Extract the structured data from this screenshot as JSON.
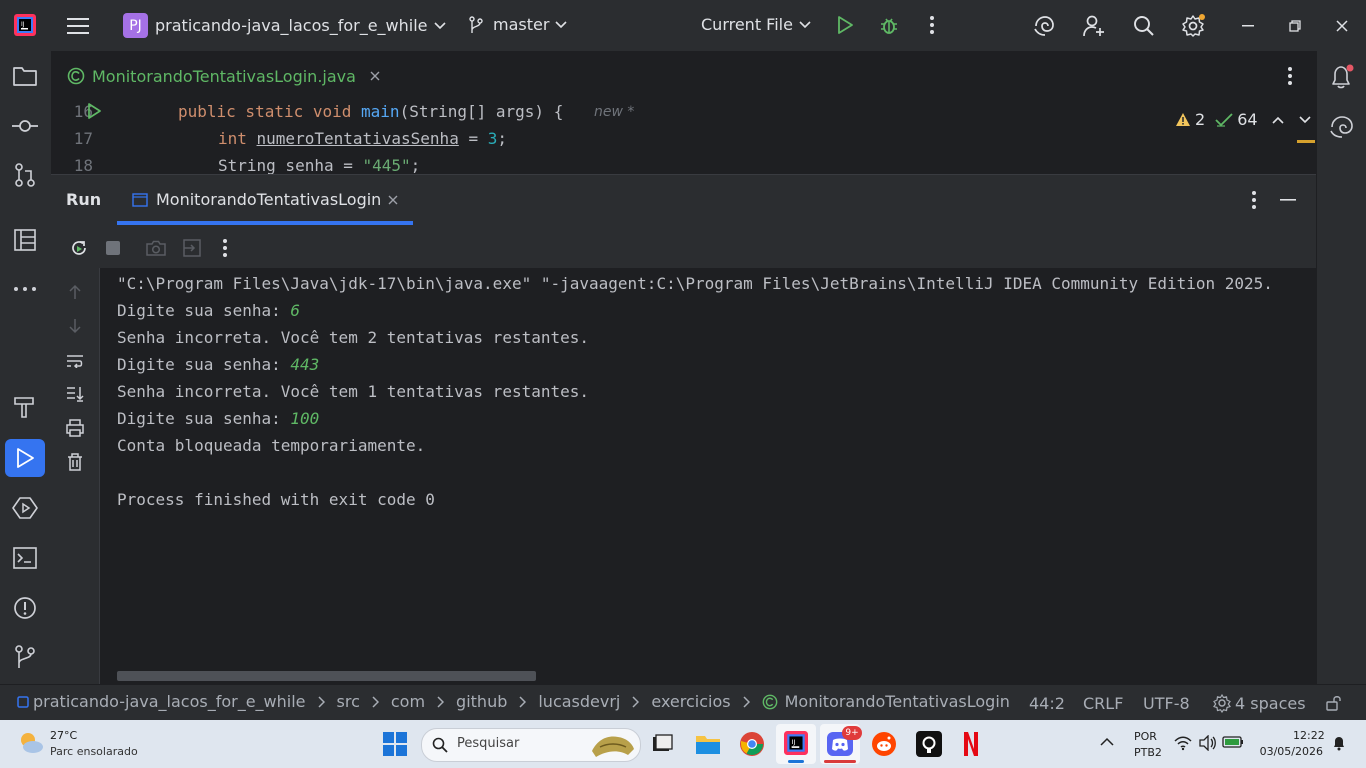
{
  "titlebar": {
    "project_badge": "PJ",
    "project_name": "praticando-java_lacos_for_e_while",
    "branch": "master",
    "run_config": "Current File",
    "window_controls": [
      "minimize-icon",
      "restore-icon",
      "close-icon"
    ]
  },
  "editor_tab": {
    "filename": "MonitorandoTentativasLogin.java"
  },
  "editor": {
    "lines": [
      {
        "num": "16",
        "code_kw": "public static void ",
        "code_fn": "main",
        "code_rest": "(String[] args) {",
        "hint": "new *"
      },
      {
        "num": "17",
        "code_kw": "int ",
        "code_var": "numeroTentativasSenha",
        "code_rest": " = ",
        "code_num": "3",
        "code_end": ";"
      },
      {
        "num": "18",
        "code_plain": "String senha = ",
        "code_str": "\"445\"",
        "code_end": ";"
      }
    ],
    "warnings": "2",
    "checks": "64"
  },
  "run_panel": {
    "title": "Run",
    "tab_label": "MonitorandoTentativasLogin"
  },
  "console": {
    "command": "\"C:\\Program Files\\Java\\jdk-17\\bin\\java.exe\" \"-javaagent:C:\\Program Files\\JetBrains\\IntelliJ IDEA Community Edition 2025.",
    "lines": [
      {
        "text": "Digite sua senha: ",
        "input": "6"
      },
      {
        "text": "Senha incorreta. Você tem 2 tentativas restantes.",
        "input": ""
      },
      {
        "text": "Digite sua senha: ",
        "input": "443"
      },
      {
        "text": "Senha incorreta. Você tem 1 tentativas restantes.",
        "input": ""
      },
      {
        "text": "Digite sua senha: ",
        "input": "100"
      },
      {
        "text": "Conta bloqueada temporariamente.",
        "input": ""
      }
    ],
    "exit": "Process finished with exit code 0"
  },
  "statusbar": {
    "breadcrumbs": [
      "praticando-java_lacos_for_e_while",
      "src",
      "com",
      "github",
      "lucasdevrj",
      "exercicios",
      "MonitorandoTentativasLogin"
    ],
    "position": "44:2",
    "line_sep": "CRLF",
    "encoding": "UTF-8",
    "indent": "4 spaces"
  },
  "taskbar": {
    "weather_temp": "27°C",
    "weather_desc": "Parc ensolarado",
    "search_placeholder": "Pesquisar",
    "discord_badge": "9+",
    "lang_top": "POR",
    "lang_bottom": "PTB2",
    "time": "12:22",
    "date": "03/05/2026"
  },
  "colors": {
    "accent": "#3574f0",
    "keyword": "#cf8e6d",
    "function": "#56a8f5",
    "number": "#2aacb8",
    "string": "#6aab73",
    "input_green": "#5fb865"
  }
}
